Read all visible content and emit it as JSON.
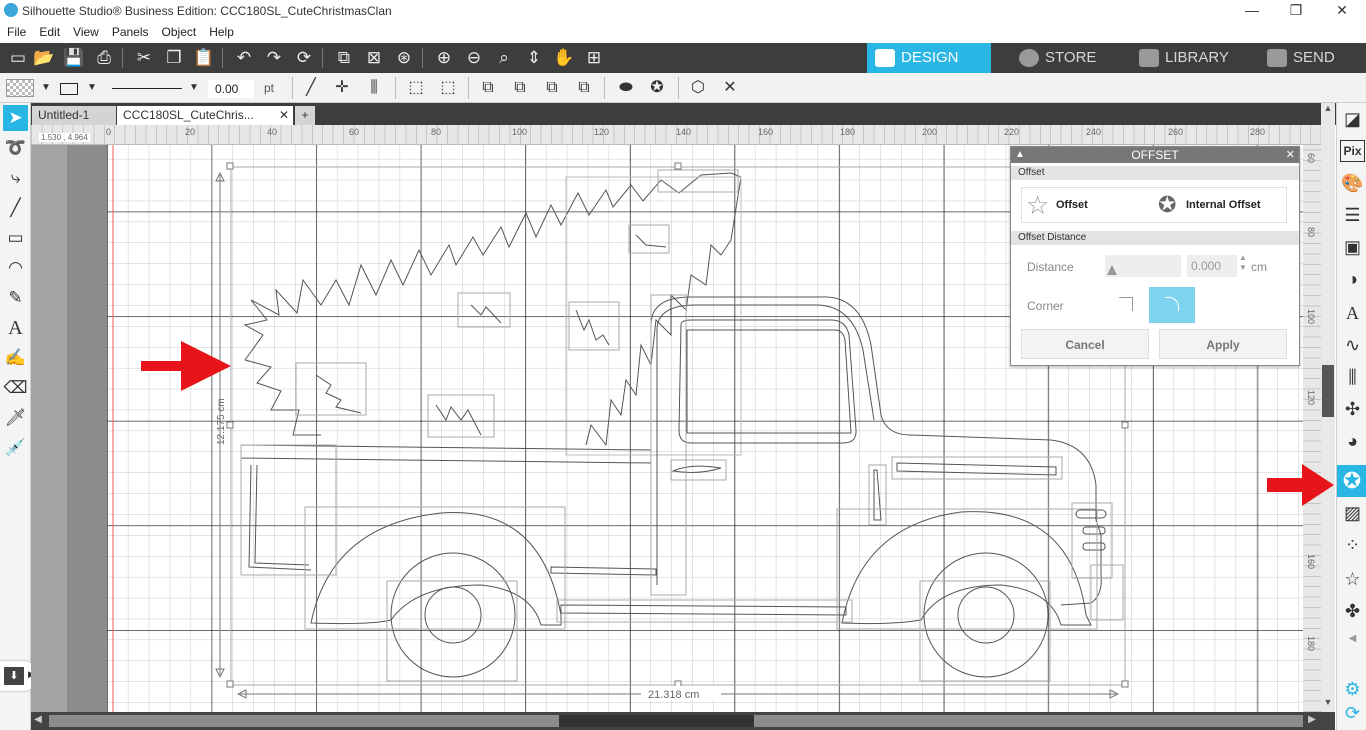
{
  "window": {
    "title": "Silhouette Studio® Business Edition: CCC180SL_CuteChristmasClan",
    "minimize": "—",
    "restore": "❐",
    "close": "✕"
  },
  "menu": [
    "File",
    "Edit",
    "View",
    "Panels",
    "Object",
    "Help"
  ],
  "nav_tabs": [
    {
      "label": "DESIGN",
      "active": true
    },
    {
      "label": "STORE",
      "active": false
    },
    {
      "label": "LIBRARY",
      "active": false
    },
    {
      "label": "SEND",
      "active": false
    }
  ],
  "line_style": {
    "width_value": "0.00",
    "unit": "pt"
  },
  "doc_tabs": [
    {
      "label": "Untitled-1",
      "active": false
    },
    {
      "label": "CCC180SL_CuteChris...",
      "active": true
    }
  ],
  "ruler_x": [
    "0",
    "20",
    "40",
    "60",
    "80",
    "100",
    "120",
    "140",
    "160",
    "180",
    "200",
    "220",
    "240",
    "260",
    "280"
  ],
  "ruler_y": [
    "60",
    "80",
    "100",
    "120",
    "140",
    "160",
    "180"
  ],
  "coord_readout": "1.530 , 4.964",
  "dimensions": {
    "height": "12.175 cm",
    "width": "21.318 cm"
  },
  "offset_panel": {
    "title": "OFFSET",
    "section_offset": "Offset",
    "offset_option": "Offset",
    "internal_offset_option": "Internal Offset",
    "section_distance": "Offset Distance",
    "distance_label": "Distance",
    "distance_value": "0.000",
    "distance_unit": "cm",
    "corner_label": "Corner",
    "cancel": "Cancel",
    "apply": "Apply"
  },
  "colors": {
    "accent": "#29b6e4",
    "toolbar_dark": "#3d3d3d",
    "arrow_red": "#e8141b",
    "corner_selected": "#7fd3ef"
  },
  "right_panel_icons": [
    "page-setup-icon",
    "pixscan-icon",
    "fill-color-icon",
    "line-style-icon",
    "image-effects-icon",
    "contrast-icon",
    "text-style-icon",
    "sketch-icon",
    "align-icon",
    "replicate-icon",
    "modify-icon",
    "offset-icon",
    "trace-icon",
    "transform-icon",
    "rhinestone-icon",
    "nesting-icon",
    "settings-icon"
  ],
  "left_tools": [
    "select-icon",
    "point-edit-icon",
    "draw-curve-icon",
    "line-icon",
    "rectangle-icon",
    "ellipse-icon",
    "pencil-icon",
    "text-icon",
    "sketch-pen-icon",
    "eraser-icon",
    "knife-icon",
    "eyedropper-icon"
  ]
}
